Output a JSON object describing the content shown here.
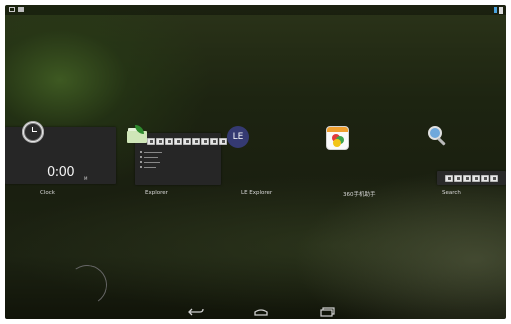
{
  "status_bar": {
    "left_icons": [
      "screenshot-icon",
      "notification-icon"
    ],
    "right_icons": [
      "signal-icon",
      "battery-icon"
    ]
  },
  "recents": [
    {
      "app": "Clock",
      "icon": "clock-icon",
      "thumbnail": {
        "time": "0:00",
        "suffix": "M"
      }
    },
    {
      "app": "Explorer",
      "icon": "folder-leaf-icon"
    },
    {
      "app": "LE Explorer",
      "icon": "le-icon",
      "icon_text": "LE"
    },
    {
      "app": "360手机助手",
      "icon": "360-icon"
    },
    {
      "app": "Search",
      "icon": "search-icon"
    }
  ],
  "nav": {
    "buttons": [
      "back-icon",
      "home-icon",
      "recents-icon"
    ]
  },
  "colors": {
    "accent_blue": "#4aa3df",
    "le_icon_bg": "#353a72"
  }
}
